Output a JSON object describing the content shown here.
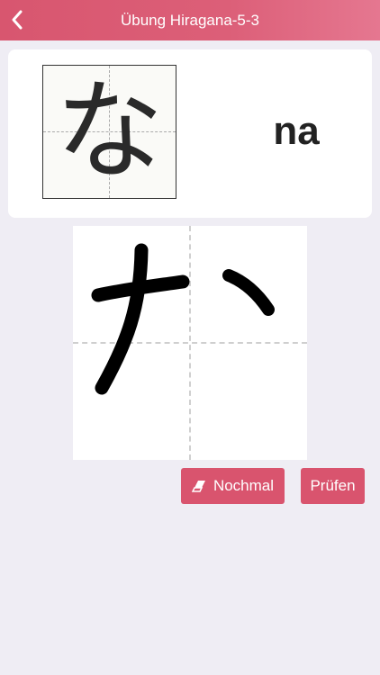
{
  "header": {
    "title": "Übung Hiragana-5-3",
    "background": "#d8566f"
  },
  "card": {
    "kana": "な",
    "romaji": "na"
  },
  "actions": {
    "again_label": "Nochmal",
    "check_label": "Prüfen",
    "accent": "#d9546e"
  },
  "icons": {
    "back": "chevron-left-icon",
    "eraser": "eraser-icon"
  }
}
